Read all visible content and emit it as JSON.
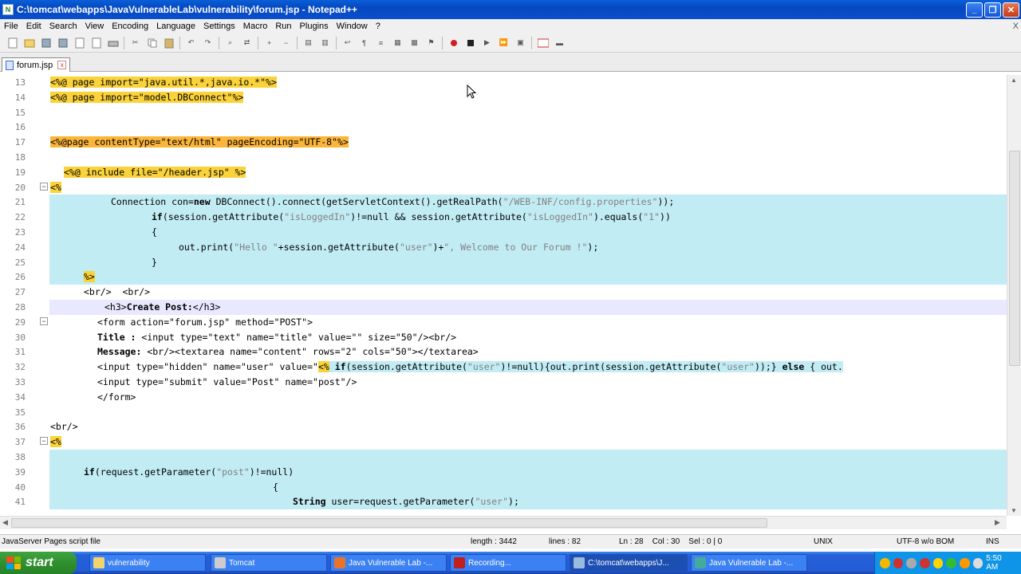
{
  "window": {
    "title": "C:\\tomcat\\webapps\\JavaVulnerableLab\\vulnerability\\forum.jsp - Notepad++",
    "minimize": "_",
    "maximize": "❐",
    "close": "✕"
  },
  "menu": [
    "File",
    "Edit",
    "Search",
    "View",
    "Encoding",
    "Language",
    "Settings",
    "Macro",
    "Run",
    "Plugins",
    "Window",
    "?"
  ],
  "menu_close": "X",
  "tab": {
    "label": "forum.jsp",
    "close": "x"
  },
  "code_lines": [
    {
      "n": "13"
    },
    {
      "n": "14"
    },
    {
      "n": "15"
    },
    {
      "n": "16"
    },
    {
      "n": "17"
    },
    {
      "n": "18"
    },
    {
      "n": "19"
    },
    {
      "n": "20"
    },
    {
      "n": "21"
    },
    {
      "n": "22"
    },
    {
      "n": "23"
    },
    {
      "n": "24"
    },
    {
      "n": "25"
    },
    {
      "n": "26"
    },
    {
      "n": "27"
    },
    {
      "n": "28"
    },
    {
      "n": "29"
    },
    {
      "n": "30"
    },
    {
      "n": "31"
    },
    {
      "n": "32"
    },
    {
      "n": "33"
    },
    {
      "n": "34"
    },
    {
      "n": "35"
    },
    {
      "n": "36"
    },
    {
      "n": "37"
    },
    {
      "n": "38"
    },
    {
      "n": "39"
    },
    {
      "n": "40"
    },
    {
      "n": "41"
    }
  ],
  "code": {
    "l13": "<%@ page import=\"java.util.*,java.io.*\"%>",
    "l14": "<%@ page import=\"model.DBConnect\"%>",
    "l17": "<%@page contentType=\"text/html\" pageEncoding=\"UTF-8\"%>",
    "l19": "<%@ include file=\"/header.jsp\" %>",
    "l20": "<%",
    "l21a": "Connection con=",
    "l21b": "new",
    "l21c": " DBConnect().connect(getServletContext().getRealPath(",
    "l21d": "\"/WEB-INF/config.properties\"",
    "l21e": "));",
    "l22a": "if",
    "l22b": "(session.getAttribute(",
    "l22c": "\"isLoggedIn\"",
    "l22d": ")!=null && session.getAttribute(",
    "l22e": "\"isLoggedIn\"",
    "l22f": ").equals(",
    "l22g": "\"1\"",
    "l22h": "))",
    "l23": "{",
    "l24a": "out.print(",
    "l24b": "\"Hello \"",
    "l24c": "+session.getAttribute(",
    "l24d": "\"user\"",
    "l24e": ")+",
    "l24f": "\", Welcome to Our Forum !\"",
    "l24g": ");",
    "l25": "}",
    "l26": "%>",
    "l27": "<br/>  <br/>",
    "l28a": "<h3>",
    "l28b": "Create Post:",
    "l28c": "</h3>",
    "l29": "<form action=\"forum.jsp\" method=\"POST\">",
    "l30a": "Title : ",
    "l30b": "<input type=\"text\" name=\"title\" value=\"\" size=\"50\"/><br/>",
    "l31a": "Message: ",
    "l31b": "<br/><textarea name=\"content\" rows=\"2\" cols=\"50\"></textarea>",
    "l32a": "<input type=\"hidden\" name=\"user\" value=\"",
    "l32b": "<%",
    "l32c": " if",
    "l32d": "(session.getAttribute(",
    "l32e": "\"user\"",
    "l32f": ")!=null){out.print(session.getAttribute(",
    "l32g": "\"user\"",
    "l32h": "));} ",
    "l32i": "else",
    "l32j": " { out.",
    "l33": "<input type=\"submit\" value=\"Post\" name=\"post\"/>",
    "l34": "</form>",
    "l36": "<br/>",
    "l37": "<%",
    "l39a": "if",
    "l39b": "(request.getParameter(",
    "l39c": "\"post\"",
    "l39d": ")!=null)",
    "l40": "{",
    "l41a": "String",
    "l41b": " user=request.getParameter(",
    "l41c": "\"user\"",
    "l41d": ");"
  },
  "status": {
    "filetype": "JavaServer Pages script file",
    "length": "length : 3442",
    "lines": "lines : 82",
    "position": "Ln : 28    Col : 30    Sel : 0 | 0",
    "eol": "UNIX",
    "encoding": "UTF-8 w/o BOM",
    "mode": "INS"
  },
  "taskbar": {
    "start": "start",
    "tasks": [
      {
        "label": "vulnerability"
      },
      {
        "label": "Tomcat"
      },
      {
        "label": "Java Vulnerable Lab -..."
      },
      {
        "label": "Recording..."
      },
      {
        "label": "C:\\tomcat\\webapps\\J..."
      },
      {
        "label": "Java Vulnerable Lab -..."
      }
    ],
    "clock": "5:50 AM"
  },
  "colors": {
    "highlight_block": "#c2ecf4",
    "jsp_tag": "#fad23a",
    "taskbar": "#245dd6",
    "titlebar": "#0548c0"
  }
}
